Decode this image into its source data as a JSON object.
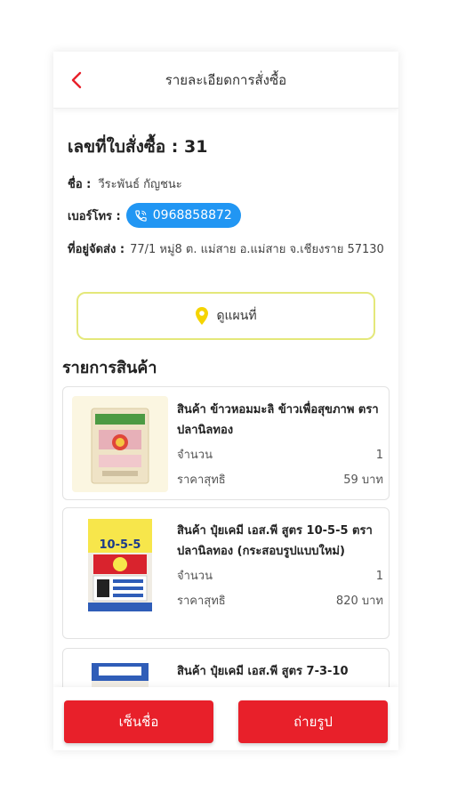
{
  "header": {
    "title": "รายละเอียดการสั่งซื้อ"
  },
  "order": {
    "number_label": "เลขที่ใบสั่งซื้อ : 31",
    "name_label": "ชื่อ :",
    "name_value": "วีระพันธ์ กัญชนะ",
    "phone_label": "เบอร์โทร :",
    "phone_value": "0968858872",
    "address_label": "ที่อยู่จัดส่ง :",
    "address_value": "77/1 หมู่8 ต. แม่สาย อ.แม่สาย จ.เชียงราย 57130"
  },
  "map_button": {
    "label": "ดูแผนที่"
  },
  "products_section": {
    "title": "รายการสินค้า"
  },
  "products": [
    {
      "name": "สินค้า  ข้าวหอมมะลิ ข้าวเพื่อสุขภาพ ตราปลานิลทอง",
      "qty_label": "จำนวน",
      "qty": "1",
      "price_label": "ราคาสุทธิ",
      "price": "59 บาท"
    },
    {
      "name": "สินค้า  ปุ๋ยเคมี เอส.พี สูตร 10-5-5 ตราปลานิลทอง (กระสอบรูปแบบใหม่)",
      "qty_label": "จำนวน",
      "qty": "1",
      "price_label": "ราคาสุทธิ",
      "price": "820 บาท",
      "bag_label": "10-5-5"
    },
    {
      "name": "สินค้า  ปุ๋ยเคมี เอส.พี สูตร 7-3-10"
    }
  ],
  "actions": {
    "sign_label": "เซ็นชื่อ",
    "photo_label": "ถ่ายรูป"
  },
  "colors": {
    "accent_red": "#e8202a",
    "phone_blue": "#2196f3",
    "map_border": "#e4e87a",
    "pin_yellow": "#f5d400"
  },
  "icons": {
    "back": "chevron-left-icon",
    "phone": "phone-icon",
    "map": "map-pin-icon"
  }
}
